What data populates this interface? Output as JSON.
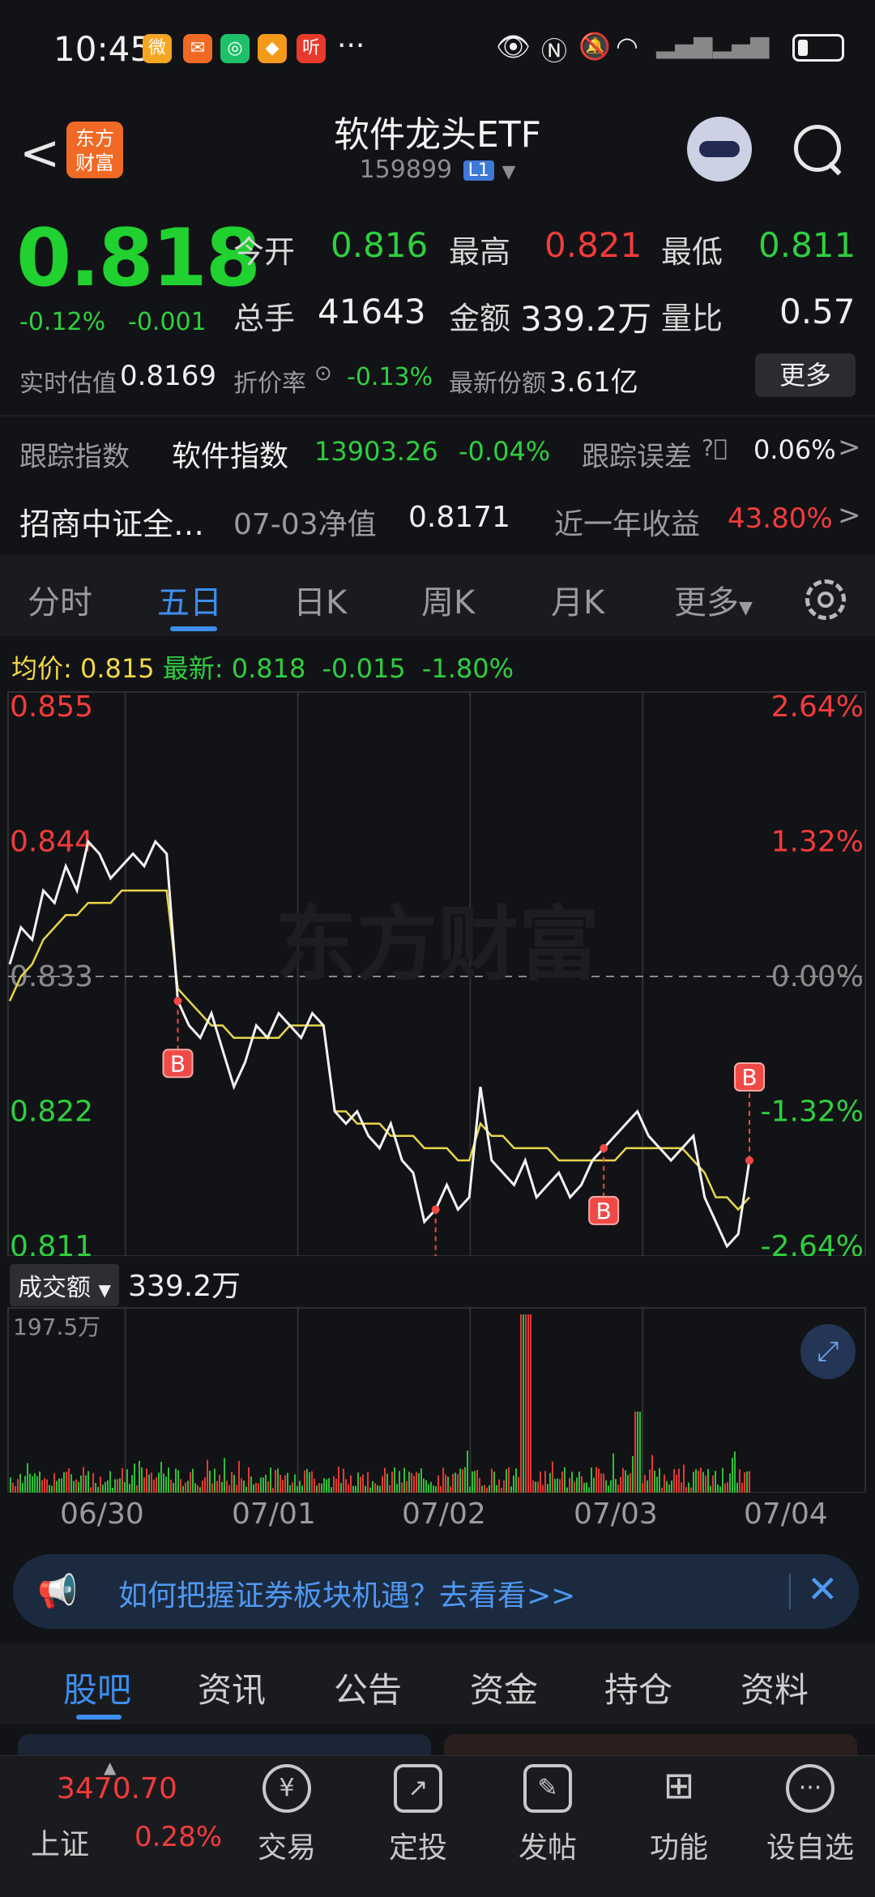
{
  "status": {
    "time": "10:45",
    "dots": "···",
    "icons": [
      "weibo-icon",
      "wechat-icon",
      "message-icon",
      "app-icon",
      "listen-icon"
    ]
  },
  "header": {
    "title": "软件龙头ETF",
    "code": "159899",
    "level": "L1",
    "logo_line1": "东方",
    "logo_line2": "财富"
  },
  "quote": {
    "price": "0.818",
    "change_pct": "-0.12%",
    "change": "-0.001",
    "open_label": "今开",
    "open": "0.816",
    "high_label": "最高",
    "high": "0.821",
    "low_label": "最低",
    "low": "0.811",
    "vol_label": "总手",
    "vol": "41643",
    "amount_label": "金额",
    "amount": "339.2万",
    "ratio_label": "量比",
    "ratio": "0.57",
    "est_label": "实时估值",
    "est": "0.8169",
    "discount_label": "折价率",
    "discount": "-0.13%",
    "shares_label": "最新份额",
    "shares": "3.61亿",
    "more": "更多"
  },
  "tracking": {
    "label": "跟踪指数",
    "index": "软件指数",
    "value": "13903.26",
    "pct": "-0.04%",
    "err_label": "跟踪误差",
    "err": "0.06%"
  },
  "fund": {
    "name": "招商中证全…",
    "nav_label": "07-03净值",
    "nav": "0.8171",
    "yr_label": "近一年收益",
    "yr": "43.80%"
  },
  "tabs": [
    "分时",
    "五日",
    "日K",
    "周K",
    "月K",
    "更多"
  ],
  "avgline": {
    "avg_label": "均价:",
    "avg": "0.815",
    "latest_label": "最新:",
    "latest": "0.818",
    "chg": "-0.015",
    "pct": "-1.80%"
  },
  "chart_data": {
    "type": "line",
    "title": "五日",
    "x": [
      "06/30",
      "07/01",
      "07/02",
      "07/03",
      "07/04"
    ],
    "ylim": [
      0.811,
      0.855
    ],
    "y_ticks_left": [
      "0.855",
      "0.844",
      "0.833",
      "0.822",
      "0.811"
    ],
    "y_ticks_right": [
      "2.64%",
      "1.32%",
      "0.00%",
      "-1.32%",
      "-2.64%"
    ],
    "prev_close": 0.833,
    "series": [
      {
        "values": [
          0.834,
          0.837,
          0.836,
          0.84,
          0.839,
          0.842,
          0.84,
          0.844,
          0.843,
          0.841,
          0.842,
          0.843,
          0.842,
          0.844,
          0.843,
          0.831,
          0.829,
          0.828,
          0.83,
          0.827,
          0.824,
          0.826,
          0.829,
          0.828,
          0.83,
          0.829,
          0.828,
          0.83,
          0.829,
          0.822,
          0.821,
          0.822,
          0.82,
          0.819,
          0.821,
          0.818,
          0.817,
          0.813,
          0.814,
          0.816,
          0.814,
          0.815,
          0.824,
          0.818,
          0.817,
          0.816,
          0.818,
          0.815,
          0.816,
          0.817,
          0.815,
          0.816,
          0.818,
          0.819,
          0.82,
          0.821,
          0.822,
          0.82,
          0.819,
          0.818,
          0.819,
          0.82,
          0.815,
          0.813,
          0.811,
          0.812,
          0.818
        ]
      },
      {
        "values": [
          0.831,
          0.833,
          0.834,
          0.836,
          0.837,
          0.838,
          0.838,
          0.839,
          0.839,
          0.839,
          0.84,
          0.84,
          0.84,
          0.84,
          0.84,
          0.832,
          0.831,
          0.83,
          0.829,
          0.829,
          0.828,
          0.828,
          0.828,
          0.828,
          0.828,
          0.829,
          0.829,
          0.829,
          0.829,
          0.822,
          0.822,
          0.821,
          0.821,
          0.821,
          0.82,
          0.82,
          0.82,
          0.819,
          0.819,
          0.819,
          0.818,
          0.818,
          0.821,
          0.82,
          0.82,
          0.819,
          0.819,
          0.819,
          0.819,
          0.818,
          0.818,
          0.818,
          0.818,
          0.818,
          0.818,
          0.819,
          0.819,
          0.819,
          0.819,
          0.819,
          0.819,
          0.818,
          0.817,
          0.815,
          0.815,
          0.814,
          0.815
        ]
      }
    ],
    "buy_marks": [
      "B",
      "B",
      "B",
      "B"
    ]
  },
  "volume": {
    "label": "成交额",
    "value": "339.2万",
    "max": "197.5万"
  },
  "banner": {
    "text": "如何把握证券板块机遇？去看看>>"
  },
  "bottom_tabs": [
    "股吧",
    "资讯",
    "公告",
    "资金",
    "持仓",
    "资料"
  ],
  "nav": {
    "index_value": "3470.70",
    "index_name": "上证",
    "index_pct": "0.28%",
    "items": [
      "交易",
      "定投",
      "发帖",
      "功能",
      "设自选"
    ]
  }
}
